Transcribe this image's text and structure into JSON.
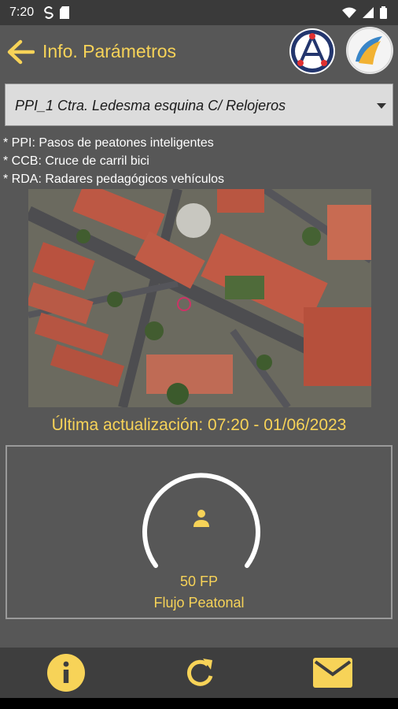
{
  "status": {
    "time": "7:20"
  },
  "header": {
    "title": "Info. Parámetros"
  },
  "dropdown": {
    "selected": "PPI_1 Ctra. Ledesma esquina C/ Relojeros"
  },
  "legend": [
    "* PPI: Pasos de peatones inteligentes",
    "* CCB: Cruce de carril bici",
    "* RDA: Radares pedagógicos vehículos"
  ],
  "update": {
    "text": "Última actualización: 07:20  -  01/06/2023"
  },
  "gauge": {
    "value": "50 FP",
    "label": "Flujo Peatonal",
    "level": 0.5
  },
  "bottom": {
    "info": "info-icon",
    "refresh": "refresh-icon",
    "mail": "mail-icon"
  },
  "colors": {
    "accent": "#f7d358",
    "background": "#575757",
    "bar": "#3e3e3e"
  }
}
